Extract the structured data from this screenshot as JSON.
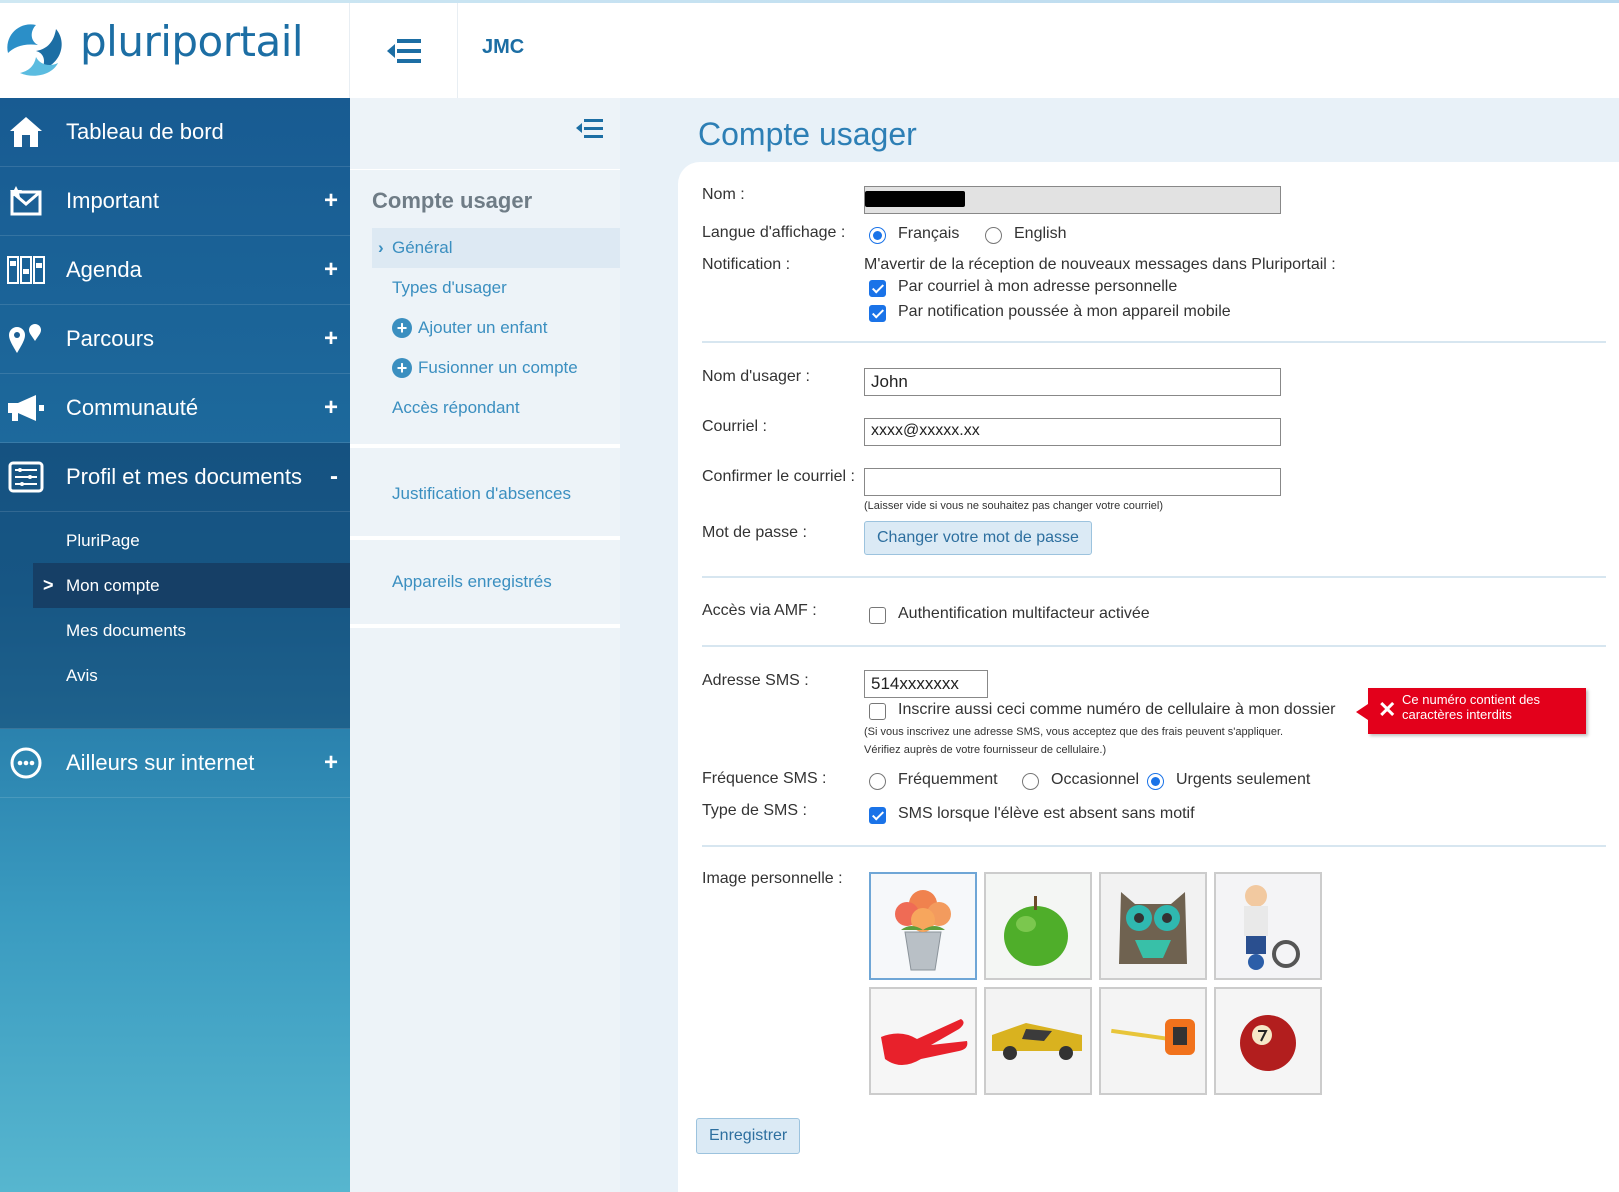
{
  "app": {
    "brand": "pluriportail",
    "org": "JMC"
  },
  "sidebar": {
    "items": [
      {
        "label": "Tableau de bord",
        "icon": "home-icon",
        "plus": ""
      },
      {
        "label": "Important",
        "icon": "mail-star-icon",
        "plus": "+"
      },
      {
        "label": "Agenda",
        "icon": "calendar-icon",
        "plus": "+"
      },
      {
        "label": "Parcours",
        "icon": "map-pin-icon",
        "plus": "+"
      },
      {
        "label": "Communauté",
        "icon": "megaphone-icon",
        "plus": "+"
      },
      {
        "label": "Profil et mes documents",
        "icon": "profile-list-icon",
        "plus": "-"
      }
    ],
    "subitems": [
      {
        "label": "PluriPage"
      },
      {
        "label": "Mon compte",
        "marker": ">"
      },
      {
        "label": "Mes documents"
      },
      {
        "label": "Avis"
      }
    ],
    "bottom": {
      "label": "Ailleurs sur internet",
      "icon": "more-circle-icon",
      "plus": "+"
    }
  },
  "secnav": {
    "title": "Compte usager",
    "links": [
      {
        "label": "Général",
        "marker": "›"
      },
      {
        "label": "Types d'usager"
      },
      {
        "label": "Ajouter un enfant",
        "plus": "+"
      },
      {
        "label": "Fusionner un compte",
        "plus": "+"
      },
      {
        "label": "Accès répondant"
      }
    ],
    "justification": "Justification d'absences",
    "devices": "Appareils enregistrés"
  },
  "page": {
    "title": "Compte usager",
    "labels": {
      "nom": "Nom :",
      "langue": "Langue d'affichage :",
      "notification": "Notification :",
      "nom_usager": "Nom d'usager :",
      "courriel": "Courriel :",
      "confirmer": "Confirmer le courriel :",
      "mot_de_passe": "Mot de passe :",
      "amf": "Accès via AMF :",
      "sms": "Adresse SMS :",
      "frequence": "Fréquence SMS :",
      "type_sms": "Type de SMS :",
      "image": "Image personnelle :"
    },
    "langue": {
      "fr": "Français",
      "en": "English",
      "selected": "fr"
    },
    "notification": {
      "intro": "M'avertir de la réception de nouveaux messages dans Pluriportail :",
      "email": "Par courriel à mon adresse personnelle",
      "push": "Par notification poussée à mon appareil mobile"
    },
    "fields": {
      "username": "John",
      "email": "xxxx@xxxxx.xx",
      "confirm_email": "",
      "confirm_hint": "(Laisser vide si vous ne souhaitez pas changer votre courriel)",
      "sms": "514xxxxxxx"
    },
    "buttons": {
      "change_password": "Changer votre mot de passe",
      "save": "Enregistrer"
    },
    "amf": "Authentification multifacteur activée",
    "sms_register": "Inscrire aussi ceci comme numéro de cellulaire à mon dossier",
    "sms_note1": "(Si vous inscrivez une adresse SMS, vous acceptez que des frais peuvent s'appliquer.",
    "sms_note2": "Vérifiez auprès de votre fournisseur de cellulaire.)",
    "error": {
      "line1": "Ce numéro contient des",
      "line2": "caractères interdits"
    },
    "frequence": {
      "opt1": "Fréquemment",
      "opt2": "Occasionnel",
      "opt3": "Urgents seulement",
      "selected": "opt3"
    },
    "type_sms": "SMS lorsque l'élève est absent sans motif",
    "images": [
      "flower-pot",
      "green-apple",
      "owl",
      "toy-figure",
      "red-glove",
      "toy-car",
      "tape-measure",
      "pool-ball-7"
    ]
  },
  "colors": {
    "brand": "#1c6ea4",
    "accent": "#2d7fb5",
    "error": "#e3001b"
  }
}
